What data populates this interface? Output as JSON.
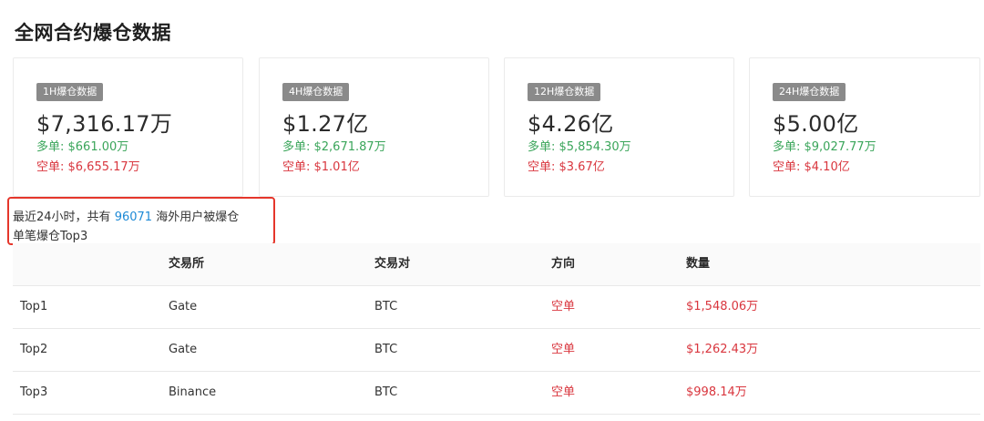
{
  "page": {
    "title": "全网合约爆仓数据"
  },
  "cards": [
    {
      "badge": "1H爆仓数据",
      "total": "$7,316.17万",
      "long": "多单: $661.00万",
      "short": "空单: $6,655.17万"
    },
    {
      "badge": "4H爆仓数据",
      "total": "$1.27亿",
      "long": "多单: $2,671.87万",
      "short": "空单: $1.01亿"
    },
    {
      "badge": "12H爆仓数据",
      "total": "$4.26亿",
      "long": "多单: $5,854.30万",
      "short": "空单: $3.67亿"
    },
    {
      "badge": "24H爆仓数据",
      "total": "$5.00亿",
      "long": "多单: $9,027.77万",
      "short": "空单: $4.10亿"
    }
  ],
  "summary": {
    "prefix": "最近24小时，共有",
    "count": "96071",
    "suffix": "海外用户被爆仓"
  },
  "top_title": "单笔爆仓Top3",
  "table": {
    "headers": [
      "",
      "交易所",
      "交易对",
      "方向",
      "数量"
    ],
    "rows": [
      [
        "Top1",
        "Gate",
        "BTC",
        "空单",
        "$1,548.06万"
      ],
      [
        "Top2",
        "Gate",
        "BTC",
        "空单",
        "$1,262.43万"
      ],
      [
        "Top3",
        "Binance",
        "BTC",
        "空单",
        "$998.14万"
      ]
    ]
  },
  "colors": {
    "long": "#3aa55a",
    "short": "#d9363e",
    "count_highlight": "#1e8ad6",
    "annotation_box": "#e5362b",
    "badge_bg": "#8a8a8a"
  }
}
